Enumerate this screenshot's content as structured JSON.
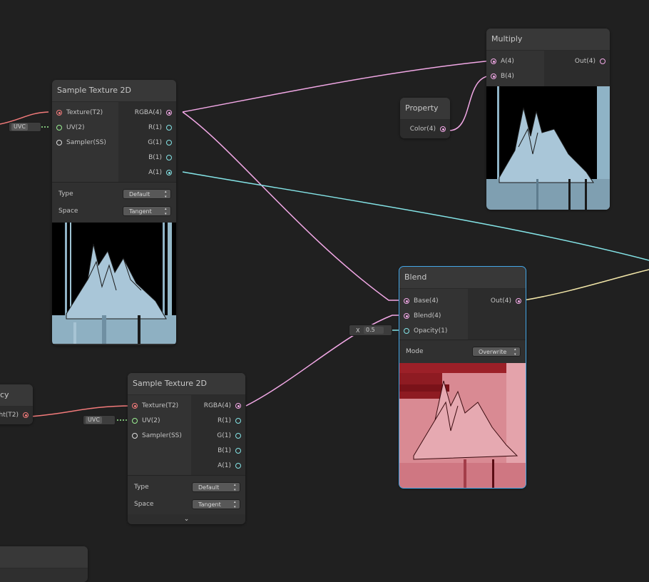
{
  "colors": {
    "background": "#202020",
    "wire_vector4": "#f2a8e6",
    "wire_vector1": "#84e4e7",
    "wire_texture": "#f27a7a",
    "wire_vector2": "#9aef92",
    "wire_yellow": "#f2e6a8",
    "selection": "#44a7e8"
  },
  "nodes": {
    "multiply": {
      "title": "Multiply",
      "inputs": [
        {
          "label": "A(4)",
          "type": "vector4"
        },
        {
          "label": "B(4)",
          "type": "vector4"
        }
      ],
      "outputs": [
        {
          "label": "Out(4)",
          "type": "vector4"
        }
      ],
      "preview": "blue-mountain"
    },
    "property": {
      "title": "Property",
      "outputs": [
        {
          "label": "Color(4)",
          "type": "vector4"
        }
      ]
    },
    "sample_texture_1": {
      "title": "Sample Texture 2D",
      "inputs": [
        {
          "label": "Texture(T2)"
        },
        {
          "label": "UV(2)"
        },
        {
          "label": "Sampler(SS)"
        }
      ],
      "outputs": [
        {
          "label": "RGBA(4)"
        },
        {
          "label": "R(1)"
        },
        {
          "label": "G(1)"
        },
        {
          "label": "B(1)"
        },
        {
          "label": "A(1)"
        }
      ],
      "settings": [
        {
          "label": "Type",
          "value": "Default"
        },
        {
          "label": "Space",
          "value": "Tangent"
        }
      ],
      "uv_chip": "UVC",
      "preview": "blue-mountain"
    },
    "sample_texture_2": {
      "title": "Sample Texture 2D",
      "inputs": [
        {
          "label": "Texture(T2)"
        },
        {
          "label": "UV(2)"
        },
        {
          "label": "Sampler(SS)"
        }
      ],
      "outputs": [
        {
          "label": "RGBA(4)"
        },
        {
          "label": "R(1)"
        },
        {
          "label": "G(1)"
        },
        {
          "label": "B(1)"
        },
        {
          "label": "A(1)"
        }
      ],
      "settings": [
        {
          "label": "Type",
          "value": "Default"
        },
        {
          "label": "Space",
          "value": "Tangent"
        }
      ],
      "uv_chip": "UVC",
      "collapse_icon": "chevron-down-icon"
    },
    "blend": {
      "title": "Blend",
      "inputs": [
        {
          "label": "Base(4)"
        },
        {
          "label": "Blend(4)"
        },
        {
          "label": "Opacity(1)"
        }
      ],
      "outputs": [
        {
          "label": "Out(4)"
        }
      ],
      "settings": [
        {
          "label": "Mode",
          "value": "Overwrite"
        }
      ],
      "opacity_field": {
        "axis": "X",
        "value": "0.5"
      },
      "preview": "red-mountain"
    },
    "partial_property": {
      "title": "cy",
      "output_label": "ht(T2)"
    }
  }
}
